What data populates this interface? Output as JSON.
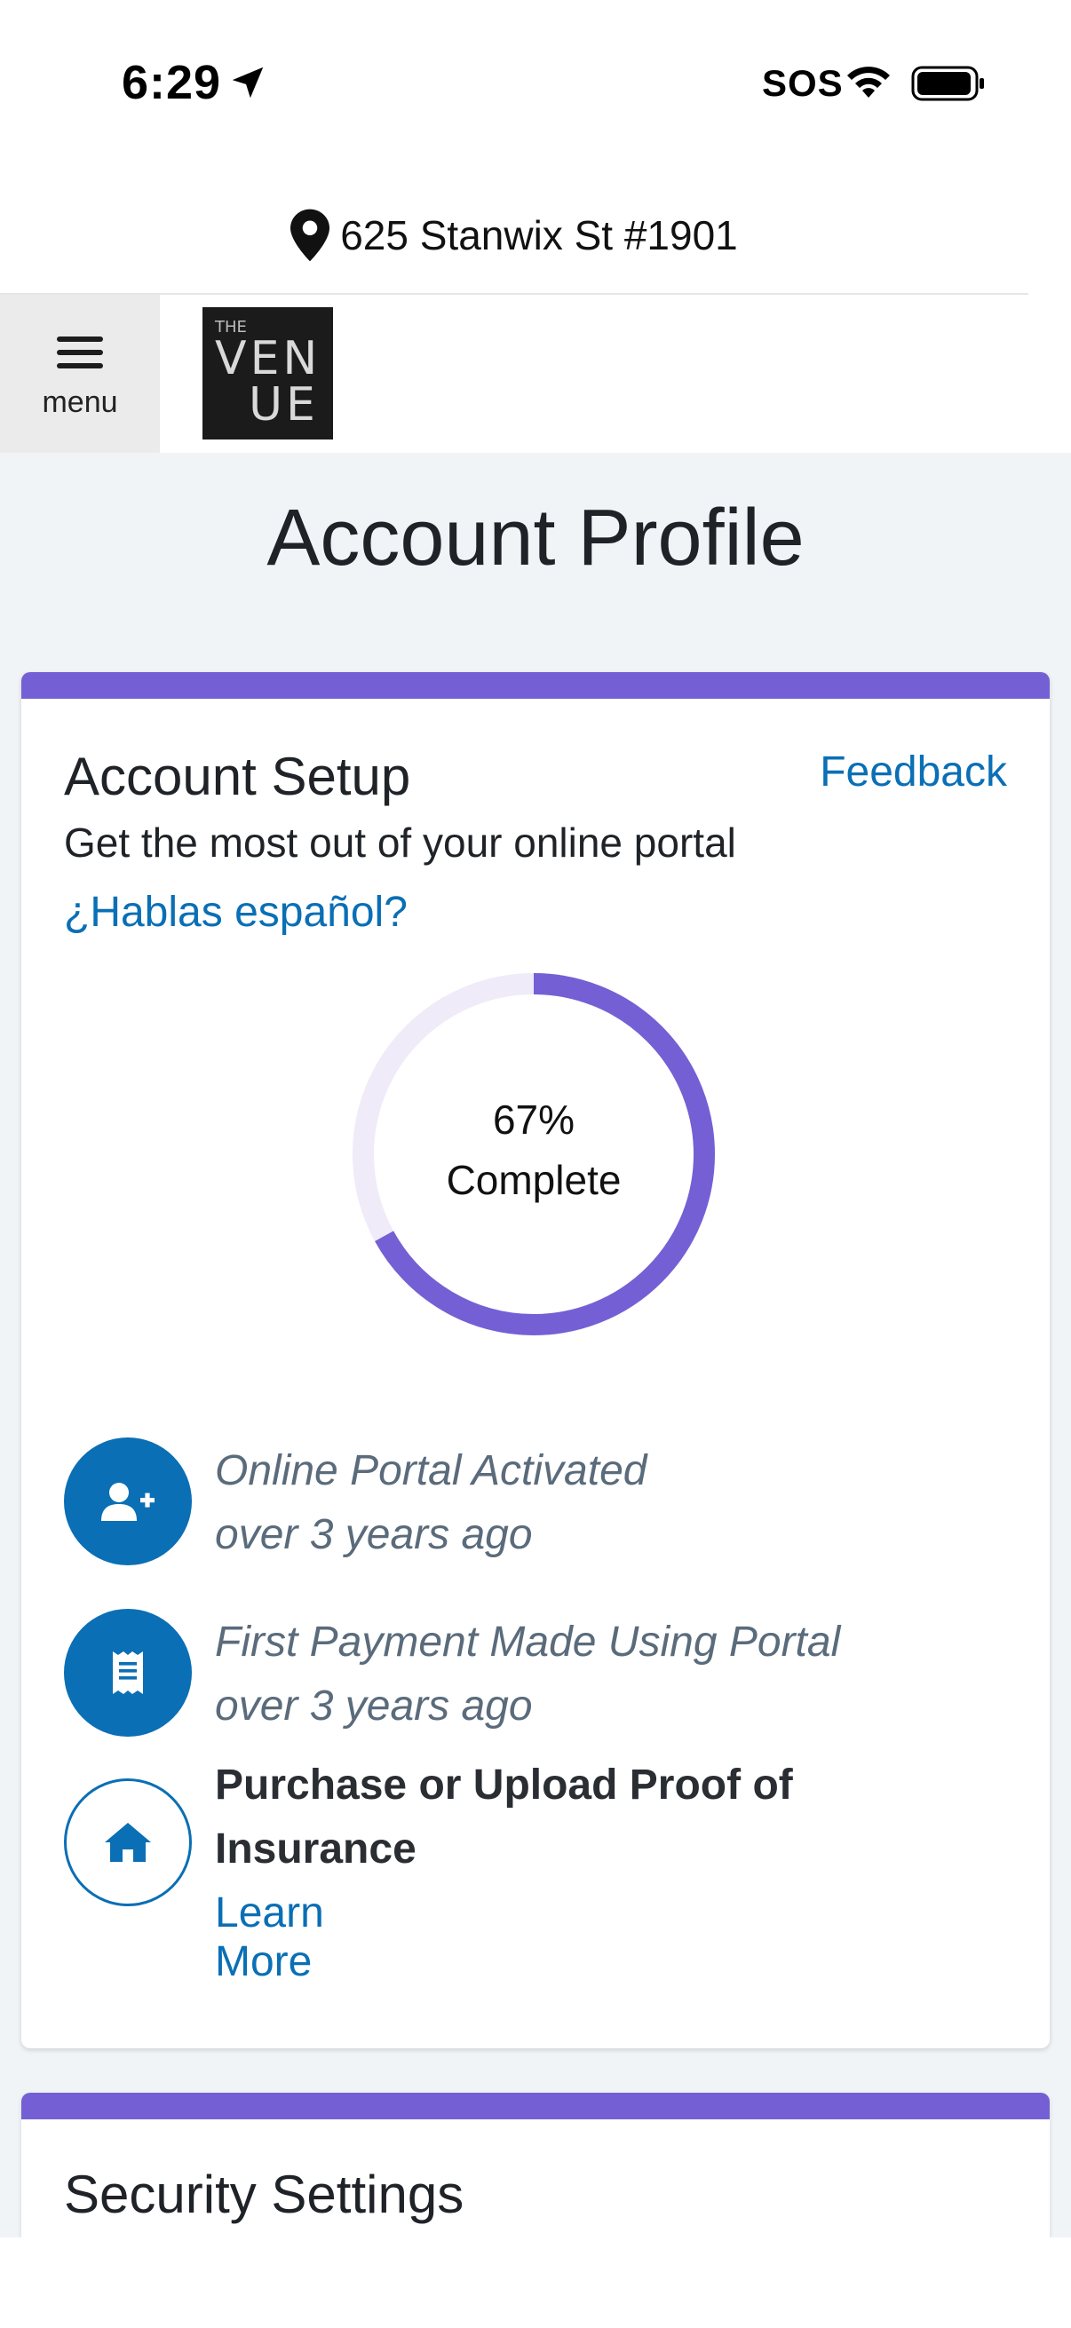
{
  "status_bar": {
    "time": "6:29",
    "carrier": "SOS"
  },
  "address": {
    "text": "625 Stanwix St #1901"
  },
  "nav": {
    "menu_label": "menu",
    "logo_small": "THE",
    "logo_line1": "VEN",
    "logo_line2": "UE"
  },
  "page": {
    "title": "Account Profile"
  },
  "account_setup": {
    "title": "Account Setup",
    "feedback_label": "Feedback",
    "subtitle": "Get the most out of your online portal",
    "spanish_link": "¿Hablas español?",
    "progress": {
      "percent": 67,
      "percent_label": "67%",
      "complete_label": "Complete"
    },
    "items": [
      {
        "title": "Online Portal Activated",
        "time": "over 3 years ago",
        "icon": "user-plus-icon",
        "done": true
      },
      {
        "title": "First Payment Made Using Portal",
        "time": "over 3 years ago",
        "icon": "receipt-icon",
        "done": true
      },
      {
        "title_line1": "Purchase or Upload Proof of",
        "title_line2": "Insurance",
        "link": "Learn More",
        "icon": "home-icon",
        "done": false
      }
    ]
  },
  "security": {
    "title": "Security Settings"
  },
  "colors": {
    "accent": "#7460d4",
    "link": "#0a6fb5",
    "track": "#efebf8"
  }
}
